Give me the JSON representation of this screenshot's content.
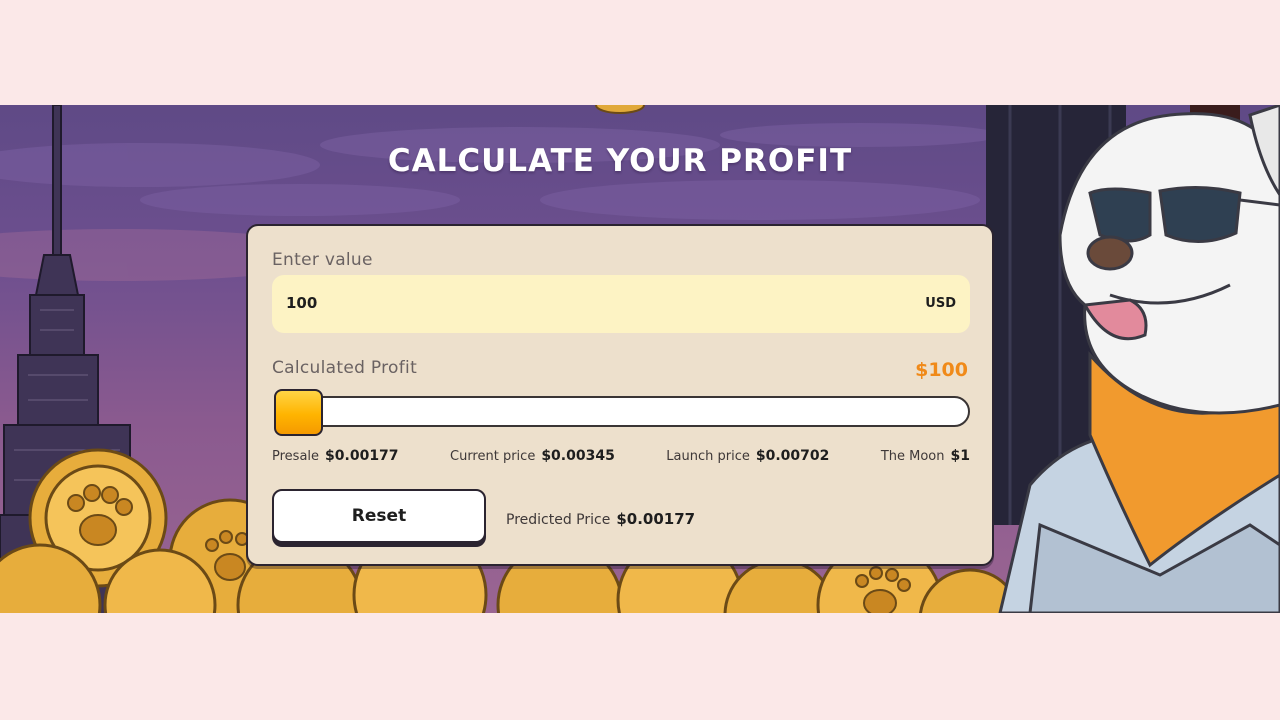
{
  "calculator": {
    "title": "CALCULATE YOUR PROFIT",
    "input_label": "Enter value",
    "input_value": "100",
    "input_unit": "USD",
    "profit_label": "Calculated Profit",
    "profit_value": "$100",
    "slider_level": 0,
    "stages": [
      {
        "name": "Presale",
        "price": "$0.00177"
      },
      {
        "name": "Current price",
        "price": "$0.00345"
      },
      {
        "name": "Launch price",
        "price": "$0.00702"
      },
      {
        "name": "The Moon",
        "price": "$1"
      }
    ],
    "reset_label": "Reset",
    "predicted_label": "Predicted Price",
    "predicted_value": "$0.00177"
  },
  "colors": {
    "page_background": "#fbe8e8",
    "sky": "#6d4f8f",
    "card_background": "#ede0cc",
    "input_background": "#fdf3c4",
    "accent_orange": "#f08a19",
    "slider_thumb": "#ffb400"
  },
  "illustration": {
    "icons": [
      "skyscraper-illustration",
      "gold-paw-coins",
      "dog-mascot-sunglasses"
    ]
  }
}
